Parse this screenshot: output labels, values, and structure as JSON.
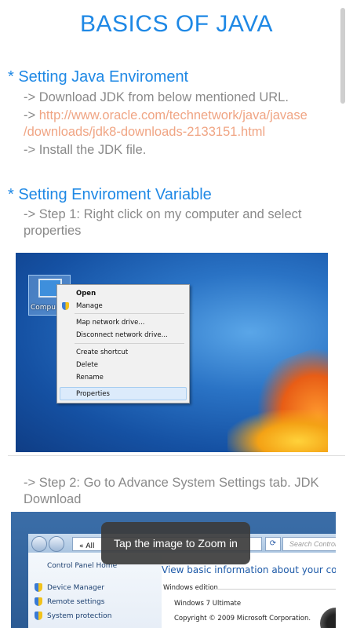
{
  "page": {
    "title": "BASICS OF JAVA"
  },
  "section1": {
    "heading": "* Setting Java Enviroment",
    "line1": "-> Download JDK from below mentioned URL.",
    "arrow": "-> ",
    "url_part1": "http://www.oracle.com/technetwork/java/javase",
    "url_part2": "/downloads/jdk8-downloads-2133151.html",
    "line3": "-> Install the JDK file."
  },
  "section2": {
    "heading": "* Setting Enviroment Variable",
    "step1": "-> Step 1: Right click on my computer and select properties",
    "step2": "-> Step 2: Go to Advance System Settings tab. JDK Download"
  },
  "screenshot1": {
    "icon_label": "Compu",
    "menu": {
      "open": "Open",
      "manage": "Manage",
      "map_network_drive": "Map network drive...",
      "disconnect_network_drive": "Disconnect network drive...",
      "create_shortcut": "Create shortcut",
      "delete": "Delete",
      "rename": "Rename",
      "properties": "Properties"
    }
  },
  "screenshot2": {
    "crumb": "« All",
    "search_placeholder": "Search Control Panel",
    "left_title": "Control Panel Home",
    "left_items": [
      "Device Manager",
      "Remote settings",
      "System protection"
    ],
    "heading": "View basic information about your computer",
    "windows_edition": "Windows edition",
    "edition_value": "Windows 7 Ultimate",
    "copyright": "Copyright © 2009 Microsoft Corporation."
  },
  "toast": {
    "message": "Tap the image to Zoom in"
  },
  "colors": {
    "accent": "#1e88e5",
    "link": "#f0a584",
    "body_text": "#8a8a8a"
  }
}
